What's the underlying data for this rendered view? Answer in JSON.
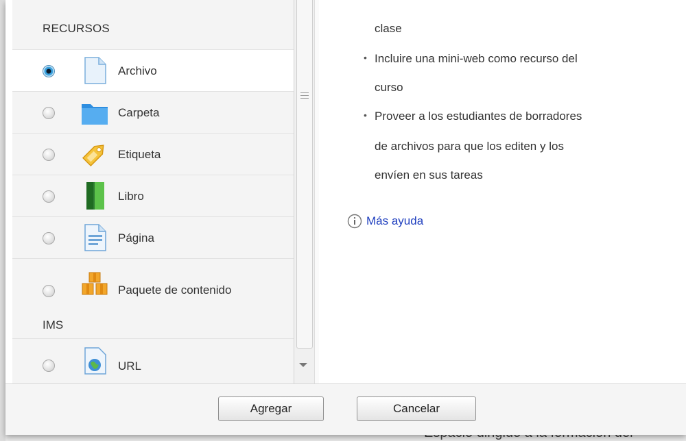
{
  "resources_section": {
    "header": "RECURSOS",
    "items": [
      {
        "label": "Archivo",
        "icon": "file-icon",
        "selected": true
      },
      {
        "label": "Carpeta",
        "icon": "folder-icon",
        "selected": false
      },
      {
        "label": "Etiqueta",
        "icon": "label-tag-icon",
        "selected": false
      },
      {
        "label": "Libro",
        "icon": "book-icon",
        "selected": false
      },
      {
        "label": "Página",
        "icon": "page-icon",
        "selected": false
      },
      {
        "label": "Paquete de contenido",
        "label_wrap": "IMS",
        "icon": "content-package-icon",
        "selected": false
      },
      {
        "label": "URL",
        "icon": "url-globe-icon",
        "selected": false
      }
    ]
  },
  "help": {
    "lines": [
      {
        "text": "clase",
        "bullet": false
      },
      {
        "text": "Incluire una mini-web como recurso del",
        "bullet": true
      },
      {
        "text": "curso",
        "bullet": false
      },
      {
        "text": "Proveer a los estudiantes de borradores",
        "bullet": true
      },
      {
        "text": "de archivos para que los editen y los",
        "bullet": false
      },
      {
        "text": "envíen en sus tareas",
        "bullet": false
      }
    ],
    "more_help_link": "Más ayuda"
  },
  "footer": {
    "add_label": "Agregar",
    "cancel_label": "Cancelar"
  },
  "background_text": "Espacio dirigido a la formación del",
  "colors": {
    "link": "#1f3fbf",
    "selected_radio": "#3aa2e0"
  }
}
